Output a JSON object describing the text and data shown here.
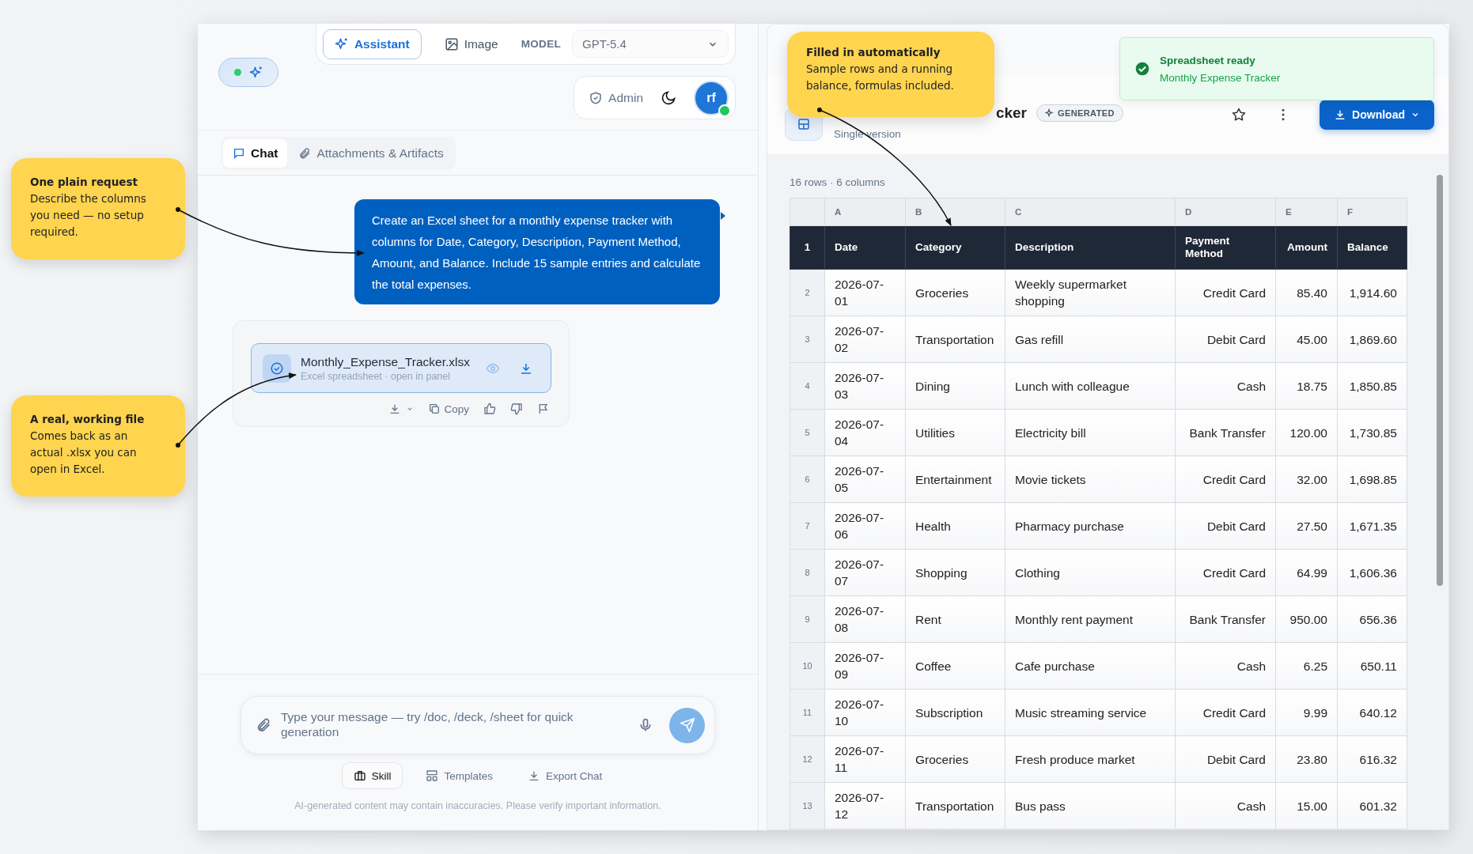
{
  "callouts": [
    {
      "title": "One plain request",
      "text": "Describe the columns you need — no setup required."
    },
    {
      "title": "A real, working file",
      "text": "Comes back as an actual .xlsx you can open in Excel."
    },
    {
      "title": "Filled in automatically",
      "text": "Sample rows and a running balance, formulas included."
    }
  ],
  "chat_panel": {
    "mode_tabs": [
      {
        "label": "Assistant",
        "selected": true
      },
      {
        "label": "Image",
        "selected": false
      }
    ],
    "model": {
      "label": "MODEL",
      "value": "GPT-5.4"
    },
    "admin_label": "Admin",
    "avatar_initials": "rf",
    "tabs": [
      {
        "label": "Chat",
        "selected": true
      },
      {
        "label": "Attachments & Artifacts",
        "selected": false
      }
    ],
    "messages": [
      {
        "kind": "user",
        "text": "Create an Excel sheet for a monthly expense tracker with columns for Date, Category, Description, Payment Method, Amount, and Balance. Include 15 sample entries and calculate the total expenses."
      },
      {
        "kind": "file",
        "name": "Monthly_Expense_Tracker.xlsx",
        "subtitle": "Excel spreadsheet · open in panel",
        "copy_label": "Copy"
      }
    ],
    "composer": {
      "placeholder": "Type your message — try /doc, /deck, /sheet for quick generation"
    },
    "tools": [
      {
        "label": "Skill",
        "selected": true
      },
      {
        "label": "Templates",
        "selected": false
      },
      {
        "label": "Export Chat",
        "selected": false
      }
    ],
    "disclaimer": "AI-generated content may contain inaccuracies. Please verify important information."
  },
  "sheet_panel": {
    "title": "cker",
    "badge": "GENERATED",
    "subtitle": "Single version",
    "download_label": "Download",
    "toast": {
      "title": "Spreadsheet ready",
      "text": "Monthly Expense Tracker"
    },
    "summary": "16 rows · 6 columns",
    "column_letters": [
      "A",
      "B",
      "C",
      "D",
      "E",
      "F"
    ],
    "header_row": {
      "number": "1",
      "cells": [
        "Date",
        "Category",
        "Description",
        "Payment Method",
        "Amount",
        "Balance"
      ]
    },
    "rows": [
      {
        "number": "2",
        "cells": [
          "2026-07-01",
          "Groceries",
          "Weekly supermarket shopping",
          "Credit Card",
          "85.40",
          "1,914.60"
        ]
      },
      {
        "number": "3",
        "cells": [
          "2026-07-02",
          "Transportation",
          "Gas refill",
          "Debit Card",
          "45.00",
          "1,869.60"
        ]
      },
      {
        "number": "4",
        "cells": [
          "2026-07-03",
          "Dining",
          "Lunch with colleague",
          "Cash",
          "18.75",
          "1,850.85"
        ]
      },
      {
        "number": "5",
        "cells": [
          "2026-07-04",
          "Utilities",
          "Electricity bill",
          "Bank Transfer",
          "120.00",
          "1,730.85"
        ]
      },
      {
        "number": "6",
        "cells": [
          "2026-07-05",
          "Entertainment",
          "Movie tickets",
          "Credit Card",
          "32.00",
          "1,698.85"
        ]
      },
      {
        "number": "7",
        "cells": [
          "2026-07-06",
          "Health",
          "Pharmacy purchase",
          "Debit Card",
          "27.50",
          "1,671.35"
        ]
      },
      {
        "number": "8",
        "cells": [
          "2026-07-07",
          "Shopping",
          "Clothing",
          "Credit Card",
          "64.99",
          "1,606.36"
        ]
      },
      {
        "number": "9",
        "cells": [
          "2026-07-08",
          "Rent",
          "Monthly rent payment",
          "Bank Transfer",
          "950.00",
          "656.36"
        ]
      },
      {
        "number": "10",
        "cells": [
          "2026-07-09",
          "Coffee",
          "Cafe purchase",
          "Cash",
          "6.25",
          "650.11"
        ]
      },
      {
        "number": "11",
        "cells": [
          "2026-07-10",
          "Subscription",
          "Music streaming service",
          "Credit Card",
          "9.99",
          "640.12"
        ]
      },
      {
        "number": "12",
        "cells": [
          "2026-07-11",
          "Groceries",
          "Fresh produce market",
          "Debit Card",
          "23.80",
          "616.32"
        ]
      },
      {
        "number": "13",
        "cells": [
          "2026-07-12",
          "Transportation",
          "Bus pass",
          "Cash",
          "15.00",
          "601.32"
        ]
      }
    ]
  }
}
